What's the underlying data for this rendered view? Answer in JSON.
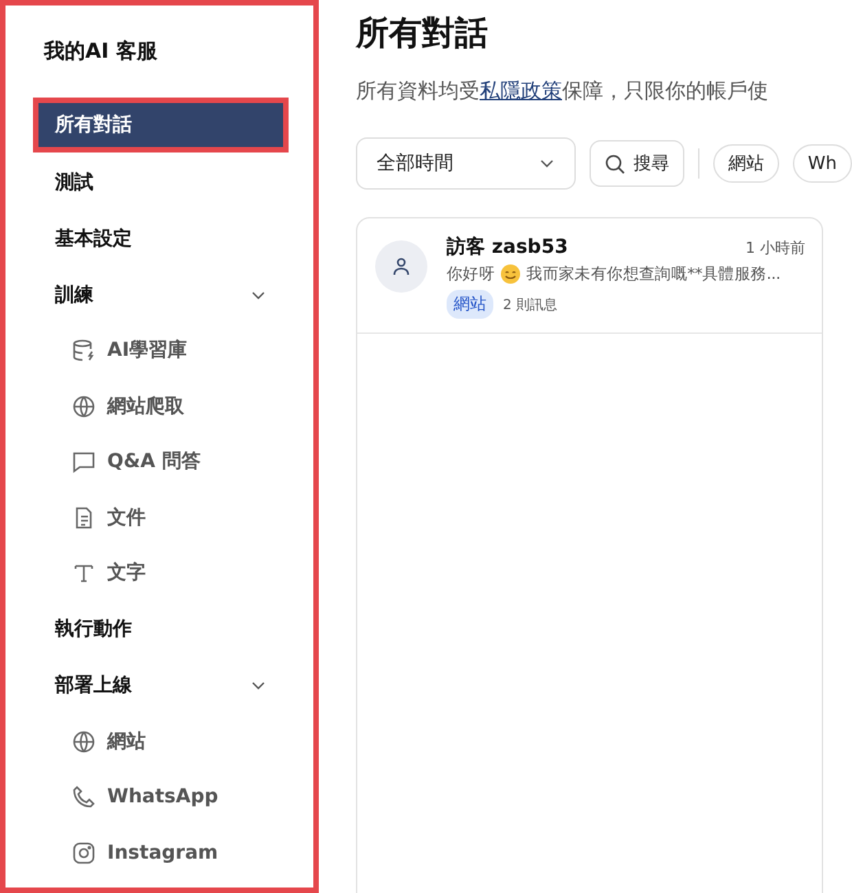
{
  "sidebar": {
    "title": "我的AI 客服",
    "items": [
      {
        "label": "所有對話",
        "selected": true
      },
      {
        "label": "測試",
        "selected": false
      },
      {
        "label": "基本設定",
        "selected": false
      },
      {
        "label": "訓練",
        "selected": false,
        "expanded": true,
        "children": [
          {
            "label": "AI學習庫",
            "kind": "database",
            "selected": false
          },
          {
            "label": "網站爬取",
            "kind": "globe",
            "selected": false
          },
          {
            "label": "Q&A 問答",
            "kind": "chat",
            "selected": false
          },
          {
            "label": "文件",
            "kind": "file",
            "selected": false
          },
          {
            "label": "文字",
            "kind": "text",
            "selected": false
          }
        ]
      },
      {
        "label": "執行動作",
        "selected": false
      },
      {
        "label": "部署上線",
        "selected": false,
        "expanded": true,
        "children": [
          {
            "label": "網站",
            "kind": "globe",
            "selected": false
          },
          {
            "label": "WhatsApp",
            "kind": "phone",
            "selected": false
          },
          {
            "label": "Instagram",
            "kind": "camera",
            "selected": false
          }
        ]
      }
    ]
  },
  "page": {
    "title": "所有對話",
    "subtitle_before": "所有資料均受",
    "subtitle_link": "私隱政策",
    "subtitle_after": "保障，只限你的帳戶使"
  },
  "filters": {
    "time": "全部時間",
    "search": "搜尋",
    "channels": [
      {
        "label": "網站",
        "selected": false
      },
      {
        "label": "Wh",
        "selected": false
      }
    ]
  },
  "conversations": [
    {
      "name": "訪客 zasb53",
      "time": "1 小時前",
      "preview_before": "你好呀",
      "preview_after": "我而家未有你想查詢嘅**具體服務...",
      "channel": "網站",
      "count": "2 則訊息"
    }
  ]
}
